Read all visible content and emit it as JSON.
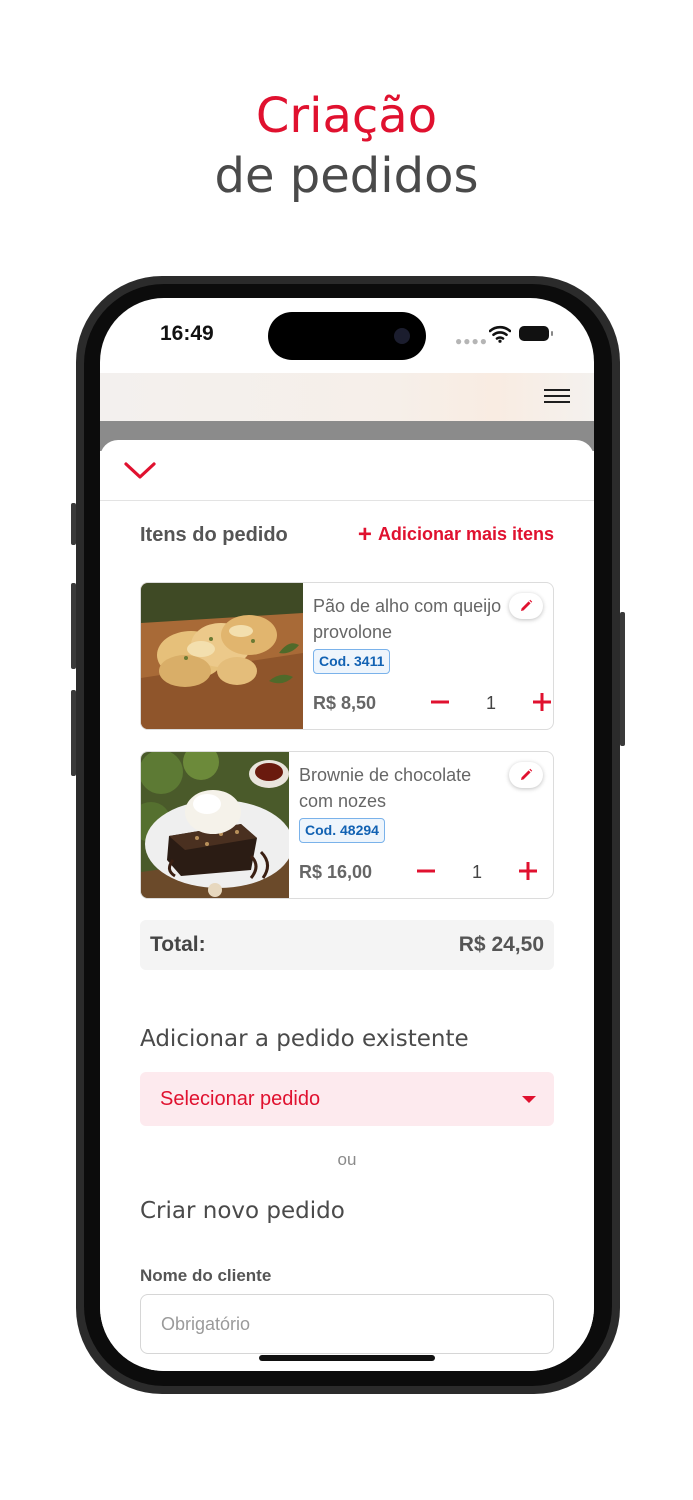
{
  "headline": {
    "line1": "Criação",
    "line2": "de pedidos"
  },
  "status_bar": {
    "time": "16:49"
  },
  "order_items": {
    "title": "Itens do pedido",
    "add_more_label": "Adicionar mais itens",
    "items": [
      {
        "name": "Pão de alho com queijo provolone",
        "code": "Cod. 3411",
        "price": "R$ 8,50",
        "quantity": "1"
      },
      {
        "name": "Brownie de chocolate com nozes",
        "code": "Cod. 48294",
        "price": "R$ 16,00",
        "quantity": "1"
      }
    ],
    "total_label": "Total:",
    "total_value": "R$ 24,50"
  },
  "existing_order": {
    "title": "Adicionar a pedido existente",
    "select_label": "Selecionar pedido"
  },
  "or_text": "ou",
  "new_order": {
    "title": "Criar novo pedido",
    "customer_name_label": "Nome do cliente",
    "customer_name_placeholder": "Obrigatório",
    "customer_name_value": ""
  },
  "colors": {
    "accent": "#e0112f",
    "code_badge": "#1262b3",
    "text": "#555555"
  }
}
